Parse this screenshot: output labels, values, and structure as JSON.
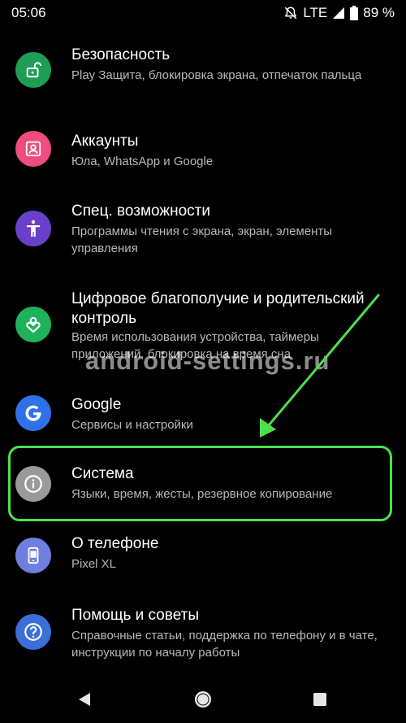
{
  "status_bar": {
    "time": "05:06",
    "network": "LTE",
    "battery": "89 %",
    "icons": [
      "dnd-off-icon",
      "signal-icon",
      "battery-icon"
    ]
  },
  "settings": [
    {
      "title": "Безопасность",
      "subtitle": "Play Защита, блокировка экрана, отпечаток пальца",
      "icon": "lock-open-icon",
      "color": "#1e9e53"
    },
    {
      "title": "Аккаунты",
      "subtitle": "Юла, WhatsApp и Google",
      "icon": "account-box-icon",
      "color": "#ee4d7e"
    },
    {
      "title": "Спец. возможности",
      "subtitle": "Программы чтения с экрана, экран, элементы управления",
      "icon": "accessibility-icon",
      "color": "#6a40c9"
    },
    {
      "title": "Цифровое благополучие и родительский контроль",
      "subtitle": "Время использования устройства, таймеры приложений, блокировка на время сна",
      "icon": "wellbeing-heart-icon",
      "color": "#1eb35a"
    },
    {
      "title": "Google",
      "subtitle": "Сервисы и настройки",
      "icon": "google-g-icon",
      "color": "#2f72e8"
    },
    {
      "title": "Система",
      "subtitle": "Языки, время, жесты, резервное копирование",
      "icon": "info-icon",
      "color": "#9a9a9a"
    },
    {
      "title": "О телефоне",
      "subtitle": "Pixel XL",
      "icon": "phone-icon",
      "color": "#6e7fe0"
    },
    {
      "title": "Помощь и советы",
      "subtitle": "Справочные статьи, поддержка по телефону и в чате, инструкции по началу работы",
      "icon": "help-icon",
      "color": "#3b6fd8"
    }
  ],
  "watermark": "android-settings.ru",
  "annotation": {
    "color": "#4ce04c"
  },
  "nav_bar": {
    "icons": [
      "back-icon",
      "home-icon",
      "recents-icon"
    ]
  }
}
